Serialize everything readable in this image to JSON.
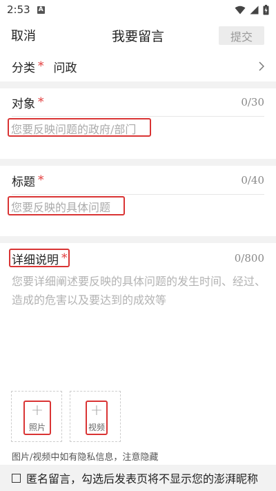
{
  "status_bar": {
    "time": "2:53",
    "notification_icon": "A"
  },
  "nav": {
    "cancel": "取消",
    "title": "我要留言",
    "submit": "提交"
  },
  "category": {
    "label": "分类",
    "required": "*",
    "value": "问政"
  },
  "target": {
    "label": "对象",
    "required": "*",
    "counter": "0/30",
    "placeholder": "您要反映问题的政府/部门"
  },
  "subject": {
    "label": "标题",
    "required": "*",
    "counter": "0/40",
    "placeholder": "您要反映的具体问题"
  },
  "detail": {
    "label": "详细说明",
    "required": "*",
    "counter": "0/800",
    "placeholder": "您要详细阐述要反映的具体问题的发生时间、经过、造成的危害以及要达到的成效等"
  },
  "uploads": {
    "photo": "照片",
    "video": "视频"
  },
  "hint": "图片/视频中如有隐私信息，注意隐藏",
  "anonymous": "匿名留言，勾选后发表页将不显示您的澎湃昵称",
  "colors": {
    "required": "#e23b3b",
    "highlight": "#d93333",
    "band": "#f2f2f2"
  }
}
